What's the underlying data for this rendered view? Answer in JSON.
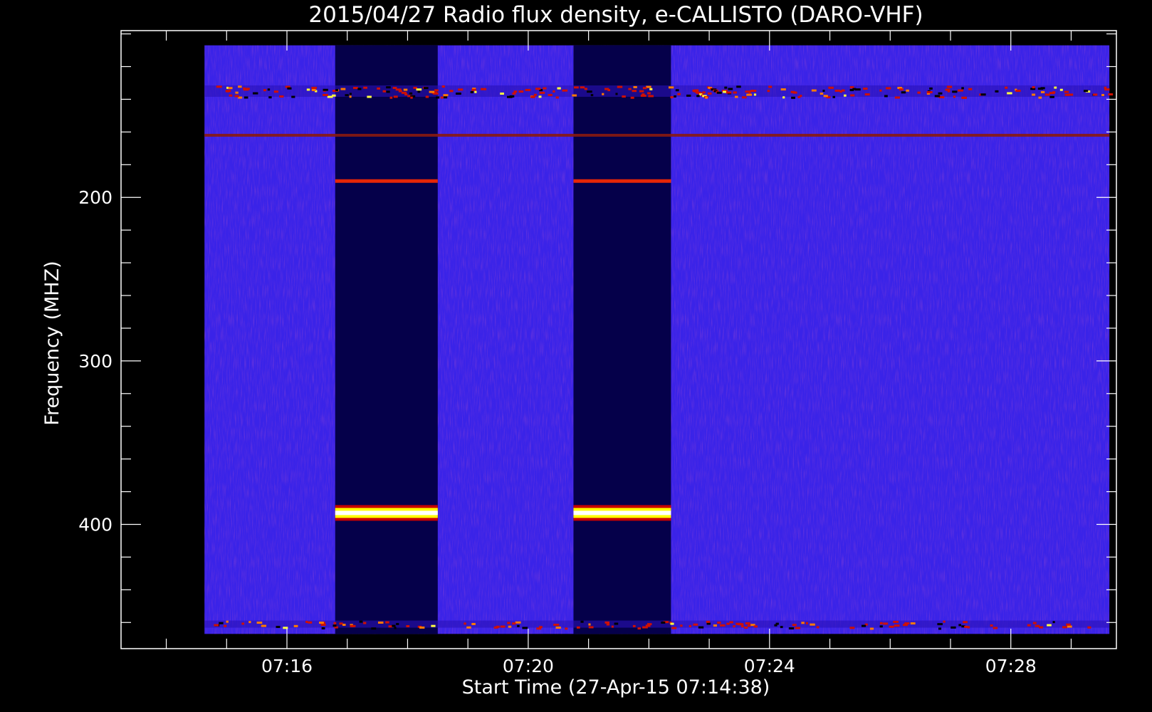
{
  "chart_data": {
    "type": "heatmap",
    "title": "2015/04/27  Radio flux density, e-CALLISTO (DARO-VHF)",
    "xlabel": "Start Time (27-Apr-15 07:14:38)",
    "ylabel": "Frequency (MHZ)",
    "x_unit": "time of day (HH:MM)",
    "xlim": [
      "07:13:15",
      "07:29:45"
    ],
    "data_time_range": [
      "07:14:38",
      "07:29:38"
    ],
    "x_major_ticks": [
      "07:16",
      "07:20",
      "07:24",
      "07:28"
    ],
    "x_minor_tick_step_minutes": 1,
    "ylim": [
      476,
      98
    ],
    "data_freq_range": [
      467,
      107
    ],
    "y_major_ticks": [
      200,
      300,
      400
    ],
    "y_minor_tick_step": 20,
    "y_direction": "frequency increases downward",
    "grid": false,
    "colorscale": [
      "#000000",
      "#0000ff",
      "#ff0000",
      "#ffff00",
      "#ffffff"
    ],
    "colors": {
      "background": "#3a23e8",
      "quiet_band": "#05004a",
      "plot_frame": "#ffffff"
    },
    "features": [
      {
        "kind": "calibration",
        "level": "low",
        "t_start": "07:16:48",
        "t_end": "07:18:30",
        "f_min": 107,
        "f_max": 467
      },
      {
        "kind": "calibration",
        "level": "low",
        "t_start": "07:20:45",
        "t_end": "07:22:22",
        "f_min": 107,
        "f_max": 467
      },
      {
        "kind": "interference-line",
        "level": "high",
        "t_start": "07:16:48",
        "t_end": "07:18:30",
        "f": 190
      },
      {
        "kind": "interference-line",
        "level": "high",
        "t_start": "07:20:45",
        "t_end": "07:22:22",
        "f": 190
      },
      {
        "kind": "interference-band",
        "level": "very high",
        "t_start": "07:16:48",
        "t_end": "07:18:30",
        "f": 393
      },
      {
        "kind": "interference-band",
        "level": "very high",
        "t_start": "07:20:45",
        "t_end": "07:22:22",
        "f": 393
      },
      {
        "kind": "interference-line",
        "level": "medium",
        "t_start": "07:14:38",
        "t_end": "07:29:38",
        "f": 162
      },
      {
        "kind": "interference-band",
        "level": "high",
        "t_start": "07:14:38",
        "t_end": "07:29:38",
        "f": 135
      },
      {
        "kind": "interference-band",
        "level": "medium",
        "t_start": "07:14:38",
        "t_end": "07:29:38",
        "f": 461
      }
    ]
  }
}
